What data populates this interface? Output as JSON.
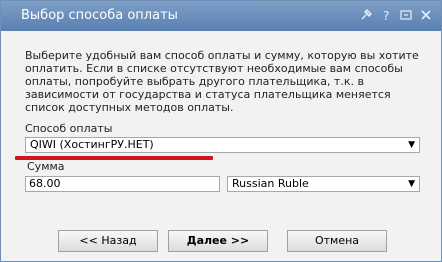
{
  "window": {
    "title": "Выбор способа оплаты",
    "icons": [
      "pin-icon",
      "help-icon",
      "restore-icon",
      "close-icon"
    ]
  },
  "description": "Выберите удобный вам способ оплаты и сумму, которую вы хотите оплатить. Если в списке отсутствуют необходимые вам способы оплаты, попробуйте выбрать другого плательщика, т.к. в зависимости от государства и статуса плательщика меняется список доступных методов оплаты.",
  "payment_method": {
    "label": "Способ оплаты",
    "selected": "QIWI (ХостингРУ.НЕТ)"
  },
  "amount": {
    "label": "Сумма",
    "value": "68.00",
    "currency_selected": "Russian Ruble"
  },
  "buttons": {
    "back": "<< Назад",
    "next": "Далее >>",
    "cancel": "Отмена"
  }
}
